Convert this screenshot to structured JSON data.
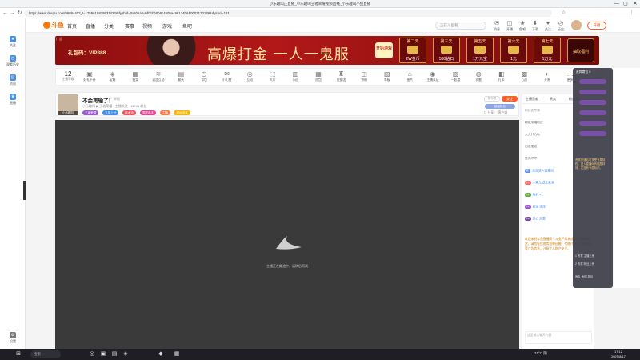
{
  "browser": {
    "tab_title": "小乐趣叫正直播_小乐趣叫王者荣耀视频直播_小乐趣叫小鱼直播",
    "url": "https://www.douyu.com/9688440?_t=1755615839931423&dyshid=0x50ba2-8db1bb0b8c4505a496174b&b0003170139&dyshci=181",
    "nav": {
      "back": "←",
      "forward": "→",
      "reload": "↻"
    },
    "window": {
      "min": "—",
      "max": "▢",
      "close": "✕"
    },
    "toolbar_icons": [
      "☆",
      "⋮"
    ]
  },
  "leftbar": {
    "items": [
      {
        "icon": "★",
        "label": "关注",
        "name": "follow"
      },
      {
        "icon": "◷",
        "label": "观看历史",
        "name": "history"
      },
      {
        "icon": "▤",
        "label": "资讯",
        "name": "news"
      },
      {
        "icon": "♛",
        "label": "直播",
        "name": "live"
      }
    ],
    "bottom": {
      "icon": "⚙",
      "label": "设置"
    }
  },
  "header": {
    "logo_text": "斗鱼",
    "nav": [
      "首页",
      "直播",
      "分类",
      "赛事",
      "视频",
      "游戏",
      "鱼吧"
    ],
    "search_placeholder": "正在斗鱼看",
    "icons": [
      {
        "g": "✉",
        "l": "消息"
      },
      {
        "g": "◫",
        "l": "开播"
      },
      {
        "g": "❀",
        "l": "鱼吧"
      },
      {
        "g": "⬇",
        "l": "下载"
      },
      {
        "g": "♥",
        "l": "关注"
      },
      {
        "g": "◴",
        "l": "历史"
      }
    ],
    "live_button": "开播"
  },
  "banner": {
    "corner_label": "广告",
    "gift_code": "礼包码：VIP888",
    "slogan": "高爆打金 一人一鬼服",
    "start_label": "开始游戏",
    "days": [
      {
        "d": "第二天",
        "p": "2W金币"
      },
      {
        "d": "第三天",
        "p": "580钻石"
      },
      {
        "d": "第五天",
        "p": "1万元宝"
      },
      {
        "d": "第六天",
        "p": "1元"
      },
      {
        "d": "第七天",
        "p": "1万元"
      }
    ],
    "luck_label": "抽取福利"
  },
  "activity": {
    "count": "12",
    "count_label": "主播等级",
    "items": [
      "好礼不停",
      "宝箱",
      "抽奖",
      "语音互动",
      "聊天",
      "背包",
      "小礼物",
      "互动",
      "大厅",
      "乐园",
      "红包",
      "应援团",
      "铁粉",
      "等级",
      "图片",
      "主播认证",
      "一起看",
      "贡献",
      "打卡",
      "心愿",
      "开黑",
      "更多"
    ]
  },
  "room": {
    "avatar_name": "小乐趣叫",
    "title": "不会再输了！",
    "subtitle": "举报",
    "meta": "小乐趣叫  ▶ 王者荣耀 · 主播关注 · 11741 粉丝",
    "tags": [
      {
        "t": "王者荣耀",
        "c": "#9b59d0"
      },
      {
        "t": "五排上分",
        "c": "#3e8ef7"
      },
      {
        "t": "技术流",
        "c": "#f5515f"
      },
      {
        "t": "国服选手",
        "c": "#e84393"
      },
      {
        "t": "主播",
        "c": "#ff7a45"
      },
      {
        "t": "好运连连",
        "c": "#f7b500"
      }
    ],
    "rank_label": "排行榜",
    "follow_label": "关注",
    "vip_label": "超级粉丝",
    "share_row": "☐ 分享   ⬚ 客户端"
  },
  "player": {
    "loading_text": "主播正在路途中，请稍后再试"
  },
  "chat": {
    "tabs": [
      "主播贡献",
      "贵宾",
      "粉丝团"
    ],
    "lines": [
      {
        "b": "",
        "bc": "",
        "t": "粉丝团专属",
        "c": "#999"
      },
      {
        "b": "",
        "bc": "",
        "t": "超级荣耀粉丝",
        "c": "#666"
      },
      {
        "b": "",
        "bc": "",
        "t": "天天开心玩",
        "c": "#666"
      },
      {
        "b": "",
        "bc": "",
        "t": "出击加油",
        "c": "#666"
      },
      {
        "b": "",
        "bc": "",
        "t": "鱼丸冲冲",
        "c": "#666"
      },
      {
        "b": "新",
        "bc": "#5b8def",
        "t": "欢迎进入直播间",
        "c": "#3e8ef7"
      },
      {
        "b": "Lv",
        "bc": "#ff6a6a",
        "t": "小鱼儿 送出礼物",
        "c": "#3e8ef7"
      },
      {
        "b": "Lv",
        "bc": "#6ab04c",
        "t": "鱼丸 ×1",
        "c": "#3e8ef7"
      },
      {
        "b": "Lv",
        "bc": "#9b59d0",
        "t": "好运 连连",
        "c": "#3e8ef7"
      },
      {
        "b": "Lv",
        "bc": "#7a4fa8",
        "t": "开心 玩耍",
        "c": "#3e8ef7"
      }
    ],
    "system_message": "欢迎来到斗鱼直播间！斗鱼严禁未成年人直播或打赏，请勿轻信各类招聘征婚、代练代充、交友聊天等广告信息，注意个人财产安全。",
    "input_placeholder": "这里输入聊天内容"
  },
  "gifts": {
    "head": "贵宾席位 0",
    "pills": 6,
    "note": "贵宾开通后可享受专属特权，进入直播间有炫酷特效，发言有专属标识。",
    "footer_lines": [
      "1 贵宾 主播上榜",
      "2 贵宾 粉丝上榜",
      "鱼丸 鱼翅 背包"
    ]
  },
  "taskbar": {
    "search_placeholder": "搜索",
    "apps": [
      "⊞",
      "◎",
      "▣",
      "▤",
      "◈",
      "◆",
      "▦"
    ],
    "weather": "31°C 阴",
    "time": "17:12",
    "date": "2025/8/17"
  }
}
